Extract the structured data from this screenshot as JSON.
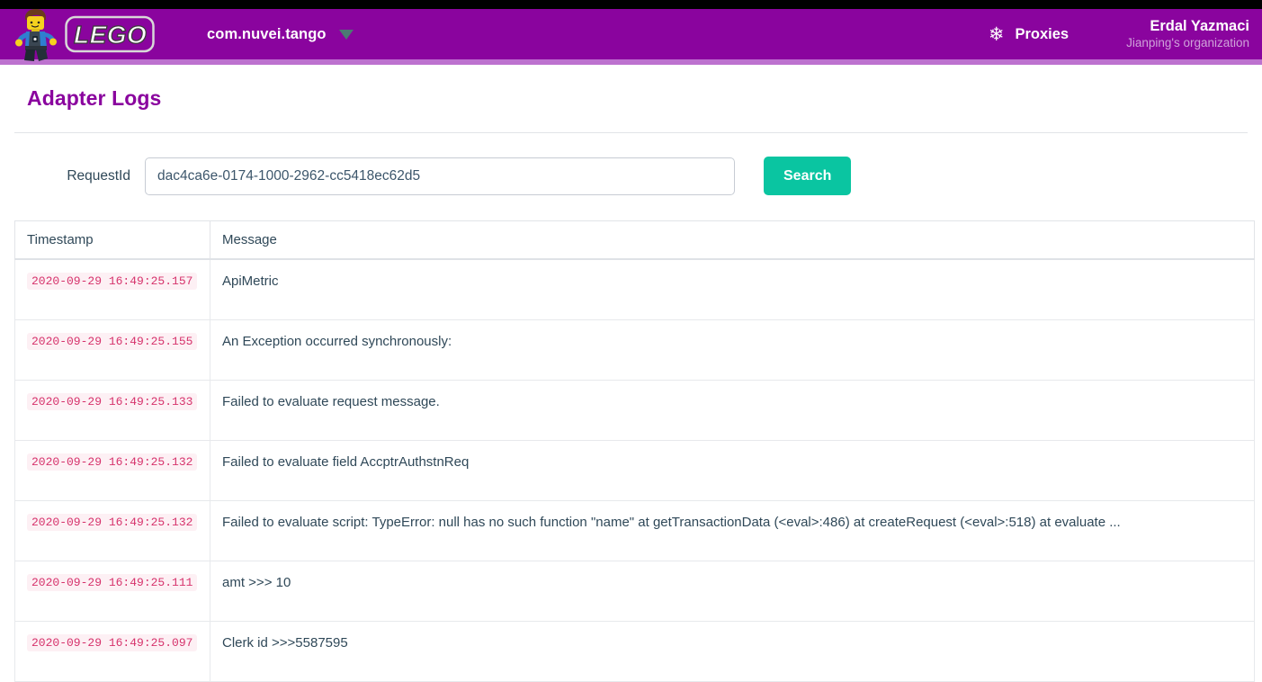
{
  "header": {
    "logo_alt": "LEGO",
    "app_selector": {
      "label": "com.nuvei.tango",
      "caret": "▼"
    },
    "proxies": {
      "label": "Proxies",
      "icon": "❄"
    },
    "user": {
      "name": "Erdal Yazmaci",
      "organization": "Jianping's organization"
    },
    "colors": {
      "header_purple": "#8a049e",
      "header_underline": "#bd72cf",
      "top_strip": "#000000"
    }
  },
  "page": {
    "title": "Adapter Logs",
    "title_color": "#8a049e"
  },
  "search": {
    "label": "RequestId",
    "value": "dac4ca6e-0174-1000-2962-cc5418ec62d5",
    "placeholder": "RequestId",
    "button_label": "Search",
    "button_color": "#0ac5a1"
  },
  "table": {
    "columns": [
      "Timestamp",
      "Message"
    ],
    "timestamp_color": "#d6336c",
    "timestamp_bg": "#fdf0f4",
    "rows": [
      {
        "timestamp": "2020-09-29 16:49:25.157",
        "message": "ApiMetric"
      },
      {
        "timestamp": "2020-09-29 16:49:25.155",
        "message": "An Exception occurred synchronously:"
      },
      {
        "timestamp": "2020-09-29 16:49:25.133",
        "message": "Failed to evaluate request message."
      },
      {
        "timestamp": "2020-09-29 16:49:25.132",
        "message": "Failed to evaluate field AccptrAuthstnReq"
      },
      {
        "timestamp": "2020-09-29 16:49:25.132",
        "message": "Failed to evaluate script: TypeError: null has no such function \"name\" at getTransactionData (<eval>:486) at createRequest (<eval>:518) at evaluate ..."
      },
      {
        "timestamp": "2020-09-29 16:49:25.111",
        "message": "amt >>> 10"
      },
      {
        "timestamp": "2020-09-29 16:49:25.097",
        "message": "Clerk id >>>5587595"
      }
    ]
  }
}
